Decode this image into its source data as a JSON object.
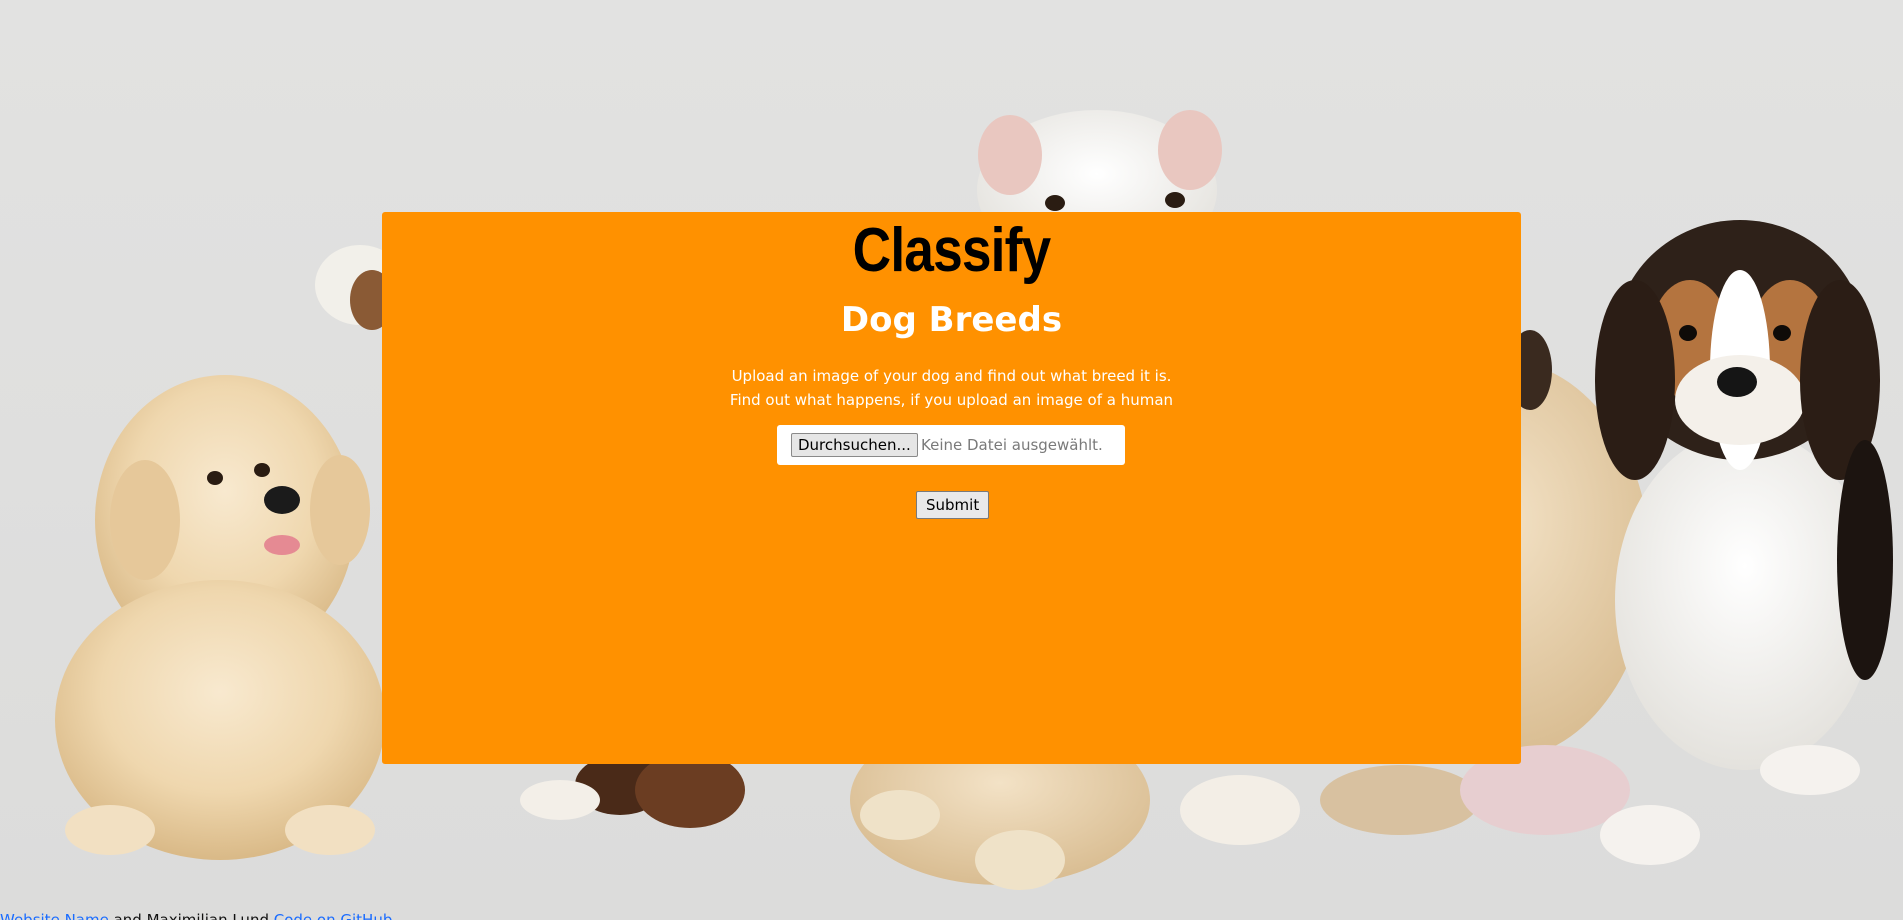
{
  "header": {
    "title": "Classify",
    "subtitle": "Dog Breeds"
  },
  "description": {
    "line1": "Upload an image of your dog and find out what breed it is.",
    "line2": "Find out what happens, if you upload an image of a human"
  },
  "upload": {
    "browse_label": "Durchsuchen...",
    "no_file_text": "Keine Datei ausgewählt."
  },
  "form": {
    "submit_label": "Submit"
  },
  "footer": {
    "link1": "Website Name",
    "by_text": " and Maximilian Lund ",
    "link2": "Code on GitHub"
  },
  "colors": {
    "card": "#ff9100",
    "background": "#e1e1e0",
    "subtitle": "#ffffff",
    "link": "#1a6cff"
  },
  "icons": {
    "background": "dogs-photo"
  }
}
